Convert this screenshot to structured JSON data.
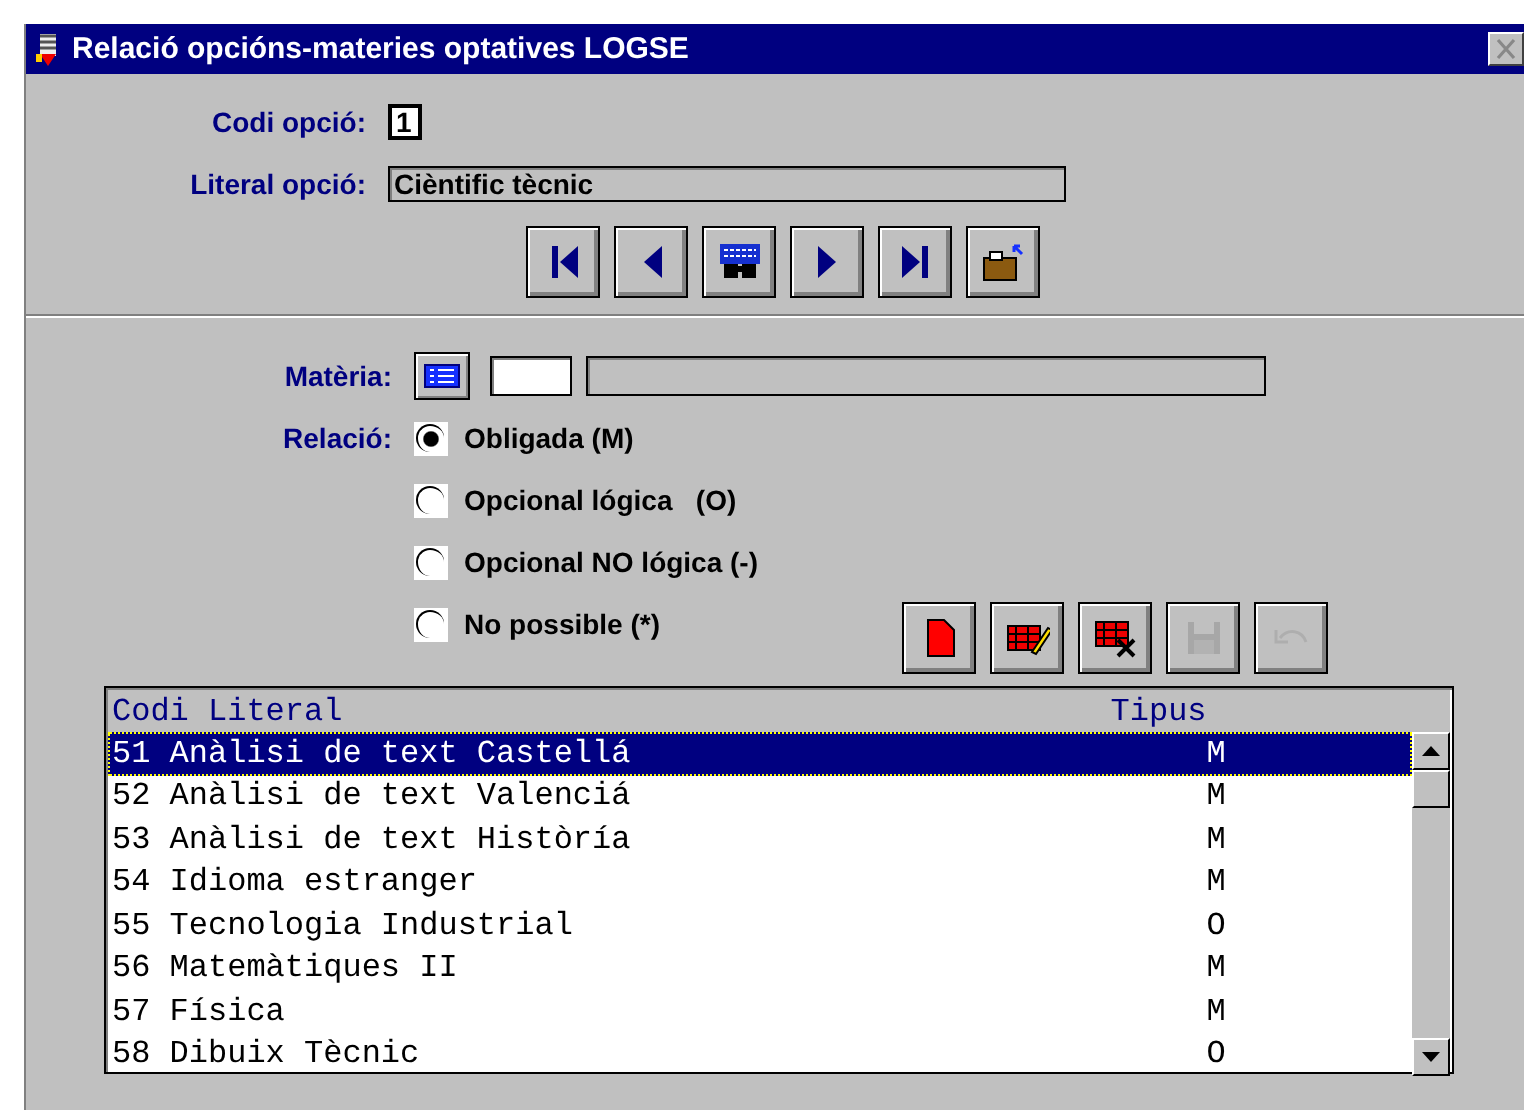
{
  "window": {
    "title": "Relació opcións-materies optatives LOGSE"
  },
  "codi_opcio": {
    "label": "Codi opció:",
    "value": "1"
  },
  "literal_opcio": {
    "label": "Literal opció:",
    "value": "Cièntific tècnic"
  },
  "nav_buttons": [
    {
      "kind": "first"
    },
    {
      "kind": "prev"
    },
    {
      "kind": "search"
    },
    {
      "kind": "next"
    },
    {
      "kind": "last"
    },
    {
      "kind": "exit"
    }
  ],
  "materia": {
    "label": "Matèria:"
  },
  "relacio": {
    "label": "Relació:",
    "options": [
      {
        "label": "Obligada (M)",
        "selected": true
      },
      {
        "label": "Opcional lógica   (O)",
        "selected": false
      },
      {
        "label": "Opcional NO lógica (-)",
        "selected": false
      },
      {
        "label": "No possible (*)",
        "selected": false
      }
    ]
  },
  "action_buttons": [
    {
      "kind": "new",
      "disabled": false
    },
    {
      "kind": "edit",
      "disabled": false
    },
    {
      "kind": "delete",
      "disabled": false
    },
    {
      "kind": "save",
      "disabled": true
    },
    {
      "kind": "undo",
      "disabled": true
    }
  ],
  "table": {
    "columns": [
      "Codi",
      "Literal",
      "Tipus"
    ],
    "rows": [
      {
        "codi": "51",
        "literal": "Anàlisi de text Castellá",
        "tipus": "M",
        "selected": true
      },
      {
        "codi": "52",
        "literal": "Anàlisi de text Valenciá",
        "tipus": "M",
        "selected": false
      },
      {
        "codi": "53",
        "literal": "Anàlisi de text Històría",
        "tipus": "M",
        "selected": false
      },
      {
        "codi": "54",
        "literal": "Idioma estranger",
        "tipus": "M",
        "selected": false
      },
      {
        "codi": "55",
        "literal": "Tecnologia Industrial",
        "tipus": "O",
        "selected": false
      },
      {
        "codi": "56",
        "literal": "Matemàtiques II",
        "tipus": "M",
        "selected": false
      },
      {
        "codi": "57",
        "literal": "Física",
        "tipus": "M",
        "selected": false
      },
      {
        "codi": "58",
        "literal": "Dibuix Tècnic",
        "tipus": "O",
        "selected": false
      }
    ]
  }
}
